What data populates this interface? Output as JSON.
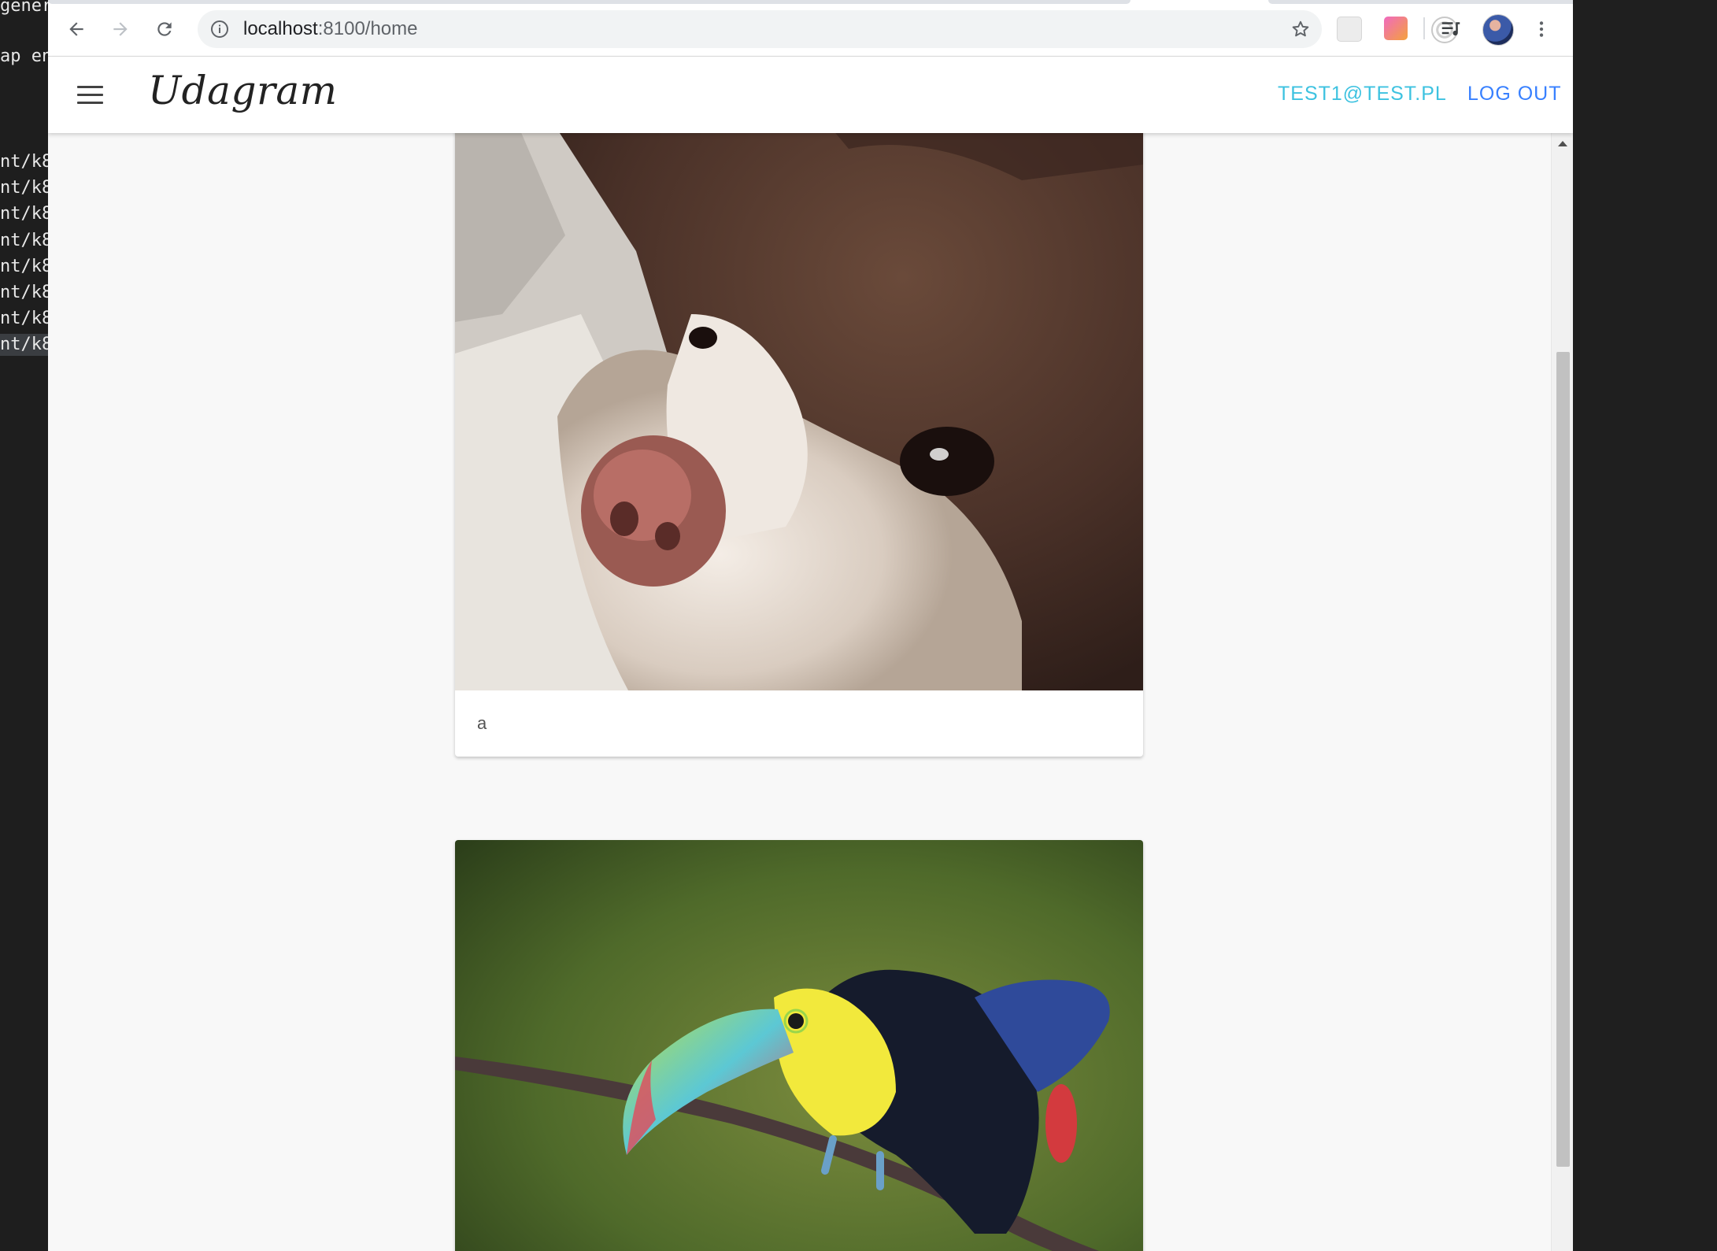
{
  "terminal": {
    "lines": [
      "gener",
      "ap en",
      "",
      "",
      "",
      "nt/k8",
      "nt/k8",
      "nt/k8",
      "nt/k8",
      "nt/k8",
      "nt/k8",
      "nt/k8",
      "nt/k8"
    ]
  },
  "browser": {
    "url_host": "localhost",
    "url_path": ":8100/home",
    "extensions": [
      "extension-icon-1",
      "extension-icon-2",
      "extension-icon-3"
    ],
    "icons": [
      "back-icon",
      "forward-icon",
      "reload-icon",
      "info-icon",
      "bookmark-star-icon",
      "media-control-icon",
      "profile-avatar",
      "more-menu-icon"
    ]
  },
  "app": {
    "brand": "Udagram",
    "user_email": "TEST1@TEST.PL",
    "logout_label": "LOG OUT",
    "accent_color": "#3dc2e0",
    "primary_color": "#3880ff"
  },
  "feed": {
    "items": [
      {
        "caption": "a",
        "image": "dog-photo"
      },
      {
        "caption": "",
        "image": "toucan-photo"
      }
    ]
  }
}
